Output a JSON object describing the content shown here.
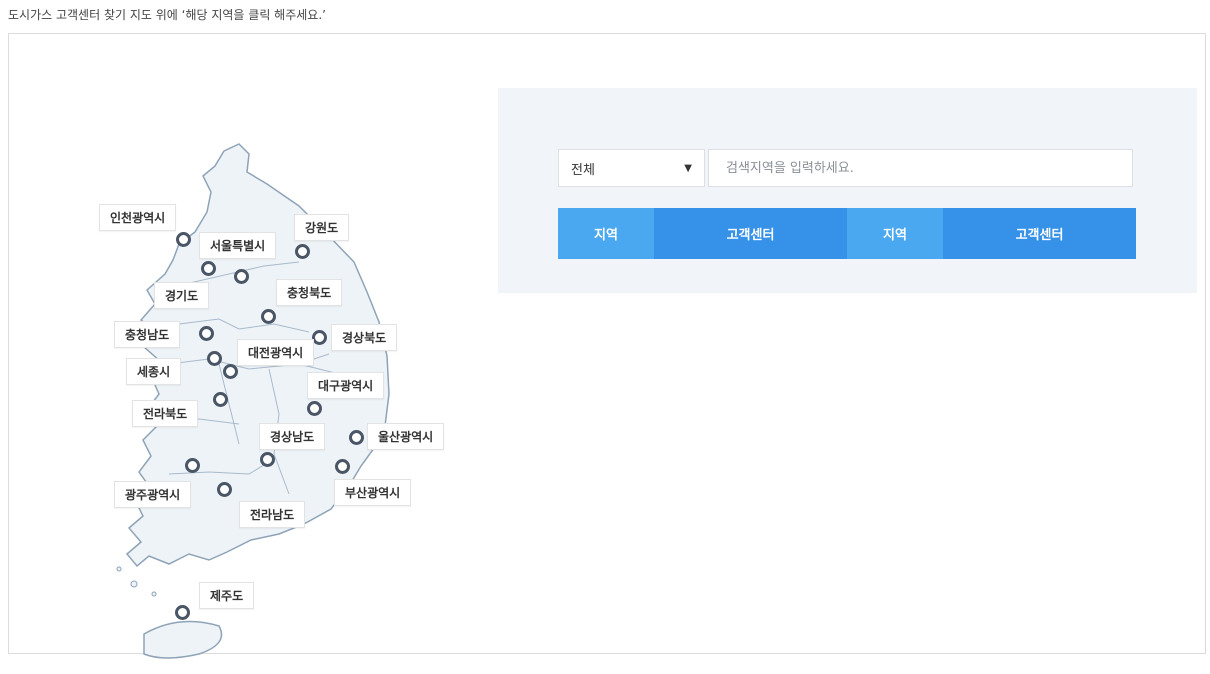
{
  "intro_text": "도시가스 고객센터 찾기 지도 위에 ‘해당 지역을 클릭 해주세요.’",
  "regions": [
    {
      "name": "인천광역시"
    },
    {
      "name": "서울특별시"
    },
    {
      "name": "강원도"
    },
    {
      "name": "경기도"
    },
    {
      "name": "충청북도"
    },
    {
      "name": "충청남도"
    },
    {
      "name": "경상북도"
    },
    {
      "name": "대전광역시"
    },
    {
      "name": "세종시"
    },
    {
      "name": "대구광역시"
    },
    {
      "name": "전라북도"
    },
    {
      "name": "경상남도"
    },
    {
      "name": "울산광역시"
    },
    {
      "name": "광주광역시"
    },
    {
      "name": "부산광역시"
    },
    {
      "name": "전라남도"
    },
    {
      "name": "제주도"
    }
  ],
  "search": {
    "select_value": "전체",
    "placeholder": "검색지역을 입력하세요."
  },
  "table": {
    "headers": [
      "지역",
      "고객센터",
      "지역",
      "고객센터"
    ]
  },
  "colors": {
    "panel_bg": "#f1f4f8",
    "header_region": "#4aa8f0",
    "header_center": "#3592e8",
    "map_fill": "#eef3f8",
    "map_stroke": "#8ea3b6"
  }
}
